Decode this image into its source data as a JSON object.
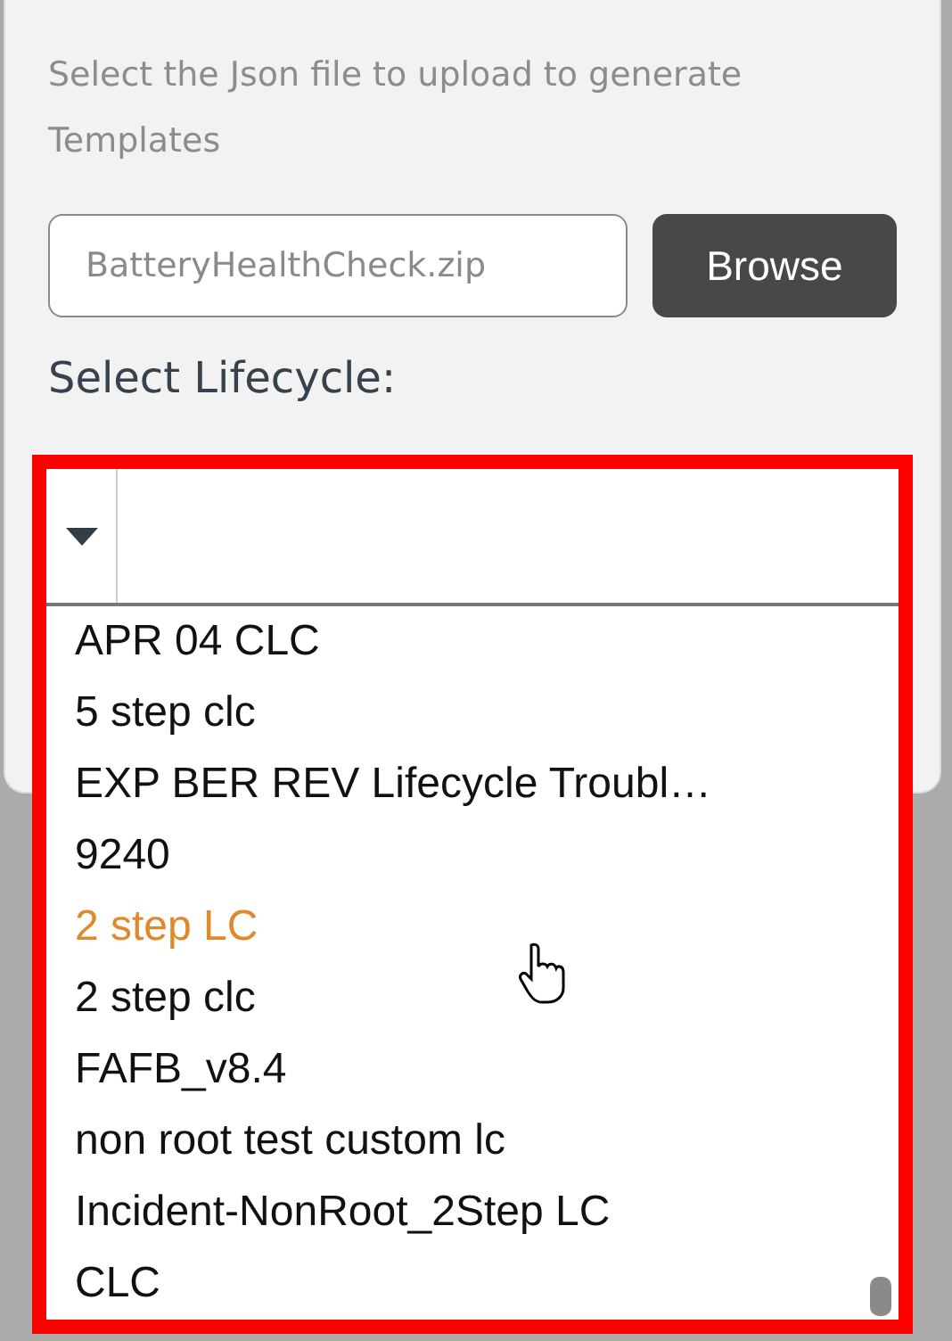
{
  "instructions": "Select the Json file to upload to generate Templates",
  "file_field": {
    "value": "BatteryHealthCheck.zip"
  },
  "browse_button": "Browse",
  "lifecycle_label": "Select Lifecycle:",
  "lifecycle_select": {
    "expanded": true,
    "options": [
      {
        "label": "APR 04 CLC",
        "highlighted": false
      },
      {
        "label": "5 step clc",
        "highlighted": false
      },
      {
        "label": "EXP BER REV Lifecycle Troubl…",
        "highlighted": false
      },
      {
        "label": "9240",
        "highlighted": false
      },
      {
        "label": "2 step LC",
        "highlighted": true
      },
      {
        "label": "2 step clc",
        "highlighted": false
      },
      {
        "label": "FAFB_v8.4",
        "highlighted": false
      },
      {
        "label": "non root test custom lc",
        "highlighted": false
      },
      {
        "label": "Incident-NonRoot_2Step LC",
        "highlighted": false
      },
      {
        "label": "CLC",
        "highlighted": false
      }
    ]
  }
}
